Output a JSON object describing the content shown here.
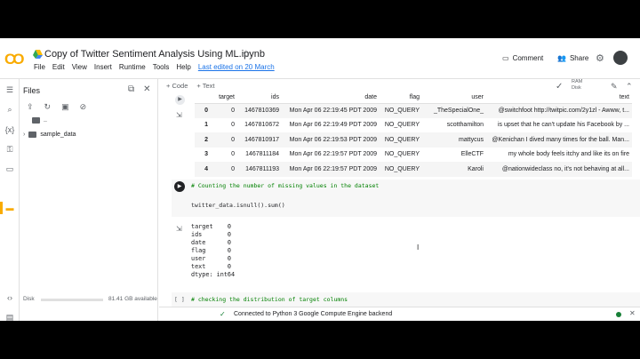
{
  "header": {
    "title": "Copy of Twitter Sentiment Analysis Using ML.ipynb",
    "menu": [
      "File",
      "Edit",
      "View",
      "Insert",
      "Runtime",
      "Tools",
      "Help"
    ],
    "last_edited": "Last edited on 20 March",
    "comment_label": "Comment",
    "share_label": "Share",
    "logo_text": "CO"
  },
  "sidebar": {
    "panel_title": "Files",
    "tree": [
      {
        "label": ".."
      },
      {
        "label": "sample_data"
      }
    ],
    "disk_label": "Disk",
    "disk_info": "81.41 GB available"
  },
  "toolbar": {
    "code_label": "+ Code",
    "text_label": "+ Text",
    "ram_label": "RAM",
    "disk_label": "Disk"
  },
  "dataframe": {
    "columns": [
      "",
      "target",
      "ids",
      "date",
      "flag",
      "user",
      "text"
    ],
    "rows": [
      [
        "0",
        "0",
        "1467810369",
        "Mon Apr 06 22:19:45 PDT 2009",
        "NO_QUERY",
        "_TheSpecialOne_",
        "@switchfoot http://twitpic.com/2y1zl - Awww, t..."
      ],
      [
        "1",
        "0",
        "1467810672",
        "Mon Apr 06 22:19:49 PDT 2009",
        "NO_QUERY",
        "scotthamilton",
        "is upset that he can't update his Facebook by ..."
      ],
      [
        "2",
        "0",
        "1467810917",
        "Mon Apr 06 22:19:53 PDT 2009",
        "NO_QUERY",
        "mattycus",
        "@Kenichan I dived many times for the ball. Man..."
      ],
      [
        "3",
        "0",
        "1467811184",
        "Mon Apr 06 22:19:57 PDT 2009",
        "NO_QUERY",
        "ElleCTF",
        "my whole body feels itchy and like its on fire"
      ],
      [
        "4",
        "0",
        "1467811193",
        "Mon Apr 06 22:19:57 PDT 2009",
        "NO_QUERY",
        "Karoli",
        "@nationwideclass no, it's not behaving at all..."
      ]
    ]
  },
  "cell2": {
    "comment": "# Counting the number of missing values in the dataset",
    "code": "twitter_data.isnull().sum()"
  },
  "output": "target    0\nids       0\ndate      0\nflag      0\nuser      0\ntext      0\ndtype: int64",
  "cell3": {
    "bracket": "[ ]",
    "comment": "# checking the distribution of target columns"
  },
  "status": {
    "text": "Connected to Python 3 Google Compute Engine backend"
  }
}
